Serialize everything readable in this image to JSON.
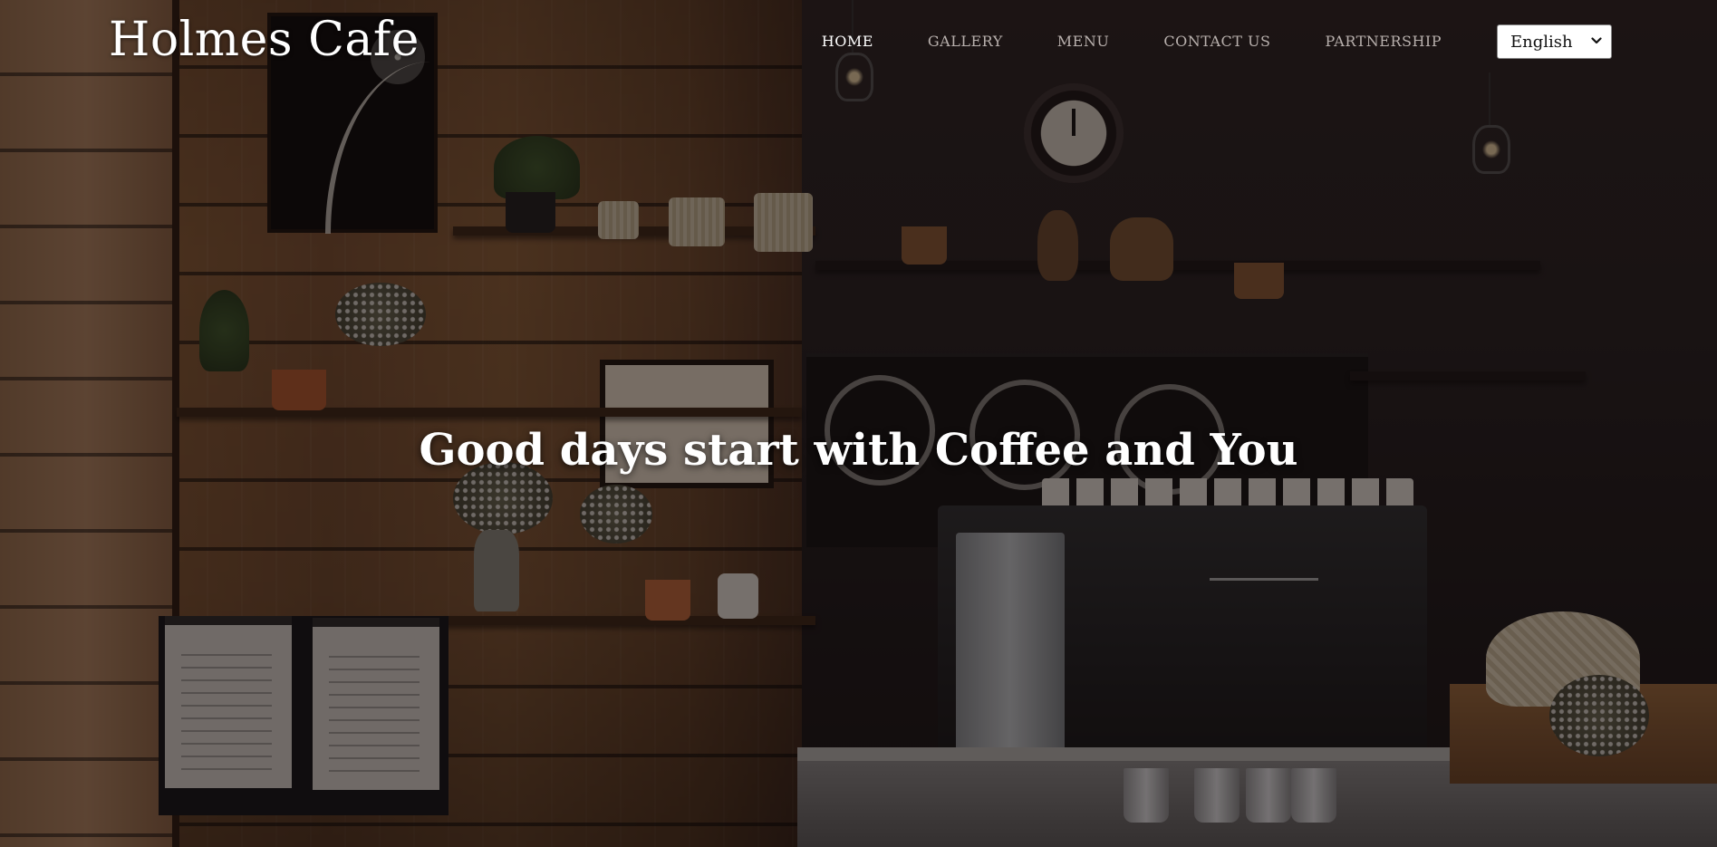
{
  "header": {
    "brand": "Holmes Cafe",
    "nav": [
      {
        "label": "HOME",
        "active": true
      },
      {
        "label": "GALLERY",
        "active": false
      },
      {
        "label": "MENU",
        "active": false
      },
      {
        "label": "CONTACT US",
        "active": false
      },
      {
        "label": "PARTNERSHIP",
        "active": false
      }
    ],
    "language": {
      "selected": "English"
    }
  },
  "hero": {
    "title": "Good days start with Coffee and You",
    "background": "cafe-interior-photo"
  },
  "colors": {
    "text": "#ffffff",
    "nav_inactive": "#b8b0ad",
    "overlay": "#100808"
  }
}
